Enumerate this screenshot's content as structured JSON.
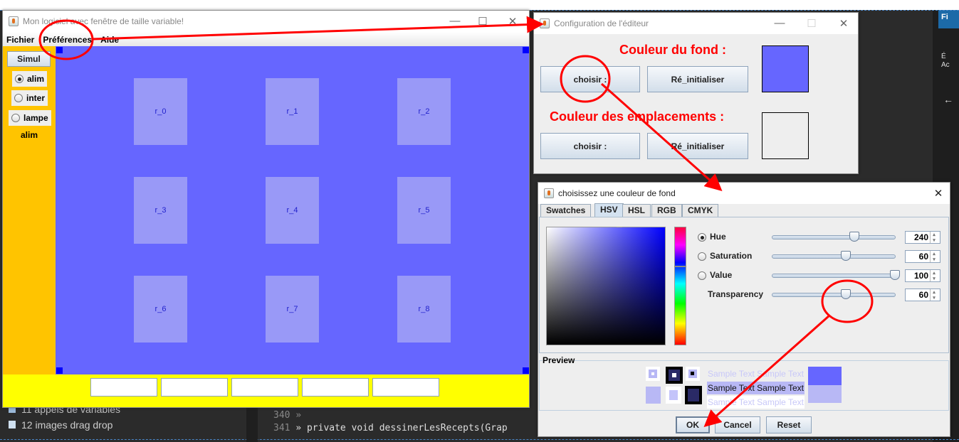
{
  "main_window": {
    "title": "Mon logiciel avec fenêtre de taille variable!",
    "menu": [
      "Fichier",
      "Préférences",
      "Aide"
    ],
    "left_panel": {
      "button": "Simul",
      "radios": [
        {
          "label": "alim",
          "selected": true
        },
        {
          "label": "inter",
          "selected": false
        },
        {
          "label": "lampe",
          "selected": false
        }
      ],
      "status": "alim"
    },
    "canvas_color": "#6666ff",
    "slots": [
      "r_0",
      "r_1",
      "r_2",
      "r_3",
      "r_4",
      "r_5",
      "r_6",
      "r_7",
      "r_8"
    ],
    "text_fields": [
      "",
      "",
      "",
      "",
      ""
    ]
  },
  "config_dialog": {
    "title": "Configuration de l'éditeur",
    "bg_heading": "Couleur du fond :",
    "slot_heading": "Couleur des emplacements :",
    "choose_label": "choisir :",
    "reset_label": "Ré_initialiser",
    "bg_color": "#6666ff",
    "slot_color": "#eeeeee"
  },
  "color_chooser": {
    "title": "choisissez une couleur de fond",
    "tabs": [
      "Swatches",
      "HSV",
      "HSL",
      "RGB",
      "CMYK"
    ],
    "active_tab": "HSV",
    "fields": [
      {
        "label": "Hue",
        "value": 240,
        "max": 360,
        "radio": true,
        "selected": true
      },
      {
        "label": "Saturation",
        "value": 60,
        "max": 100,
        "radio": true,
        "selected": false
      },
      {
        "label": "Value",
        "value": 100,
        "max": 100,
        "radio": true,
        "selected": false
      },
      {
        "label": "Transparency",
        "value": 60,
        "max": 100,
        "radio": false
      }
    ],
    "preview_label": "Preview",
    "sample_text": "Sample Text",
    "buttons": {
      "ok": "OK",
      "cancel": "Cancel",
      "reset": "Reset"
    }
  },
  "ide": {
    "tree": [
      "11 appels de variables",
      "12 images drag drop"
    ],
    "lines": [
      {
        "num": "340",
        "code": "»"
      },
      {
        "num": "341",
        "code": "»   private void dessinerLesRecepts(Grap"
      }
    ],
    "side_labels": [
      "Fi",
      "É",
      "Ac"
    ]
  }
}
